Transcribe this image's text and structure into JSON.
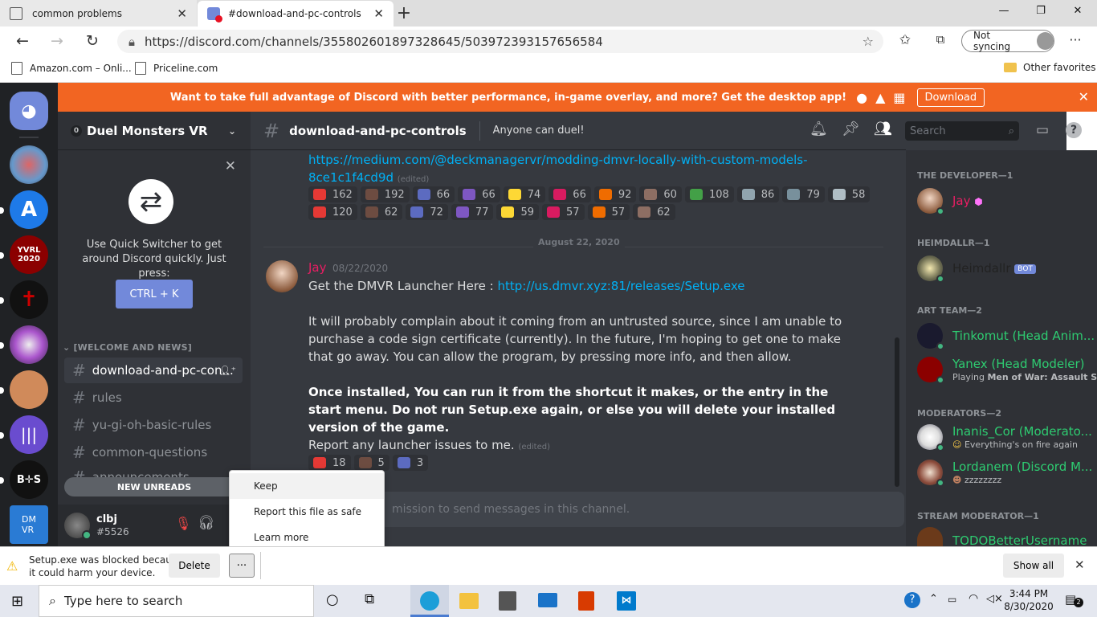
{
  "browser": {
    "tabs": [
      {
        "title": "common problems"
      },
      {
        "title": "#download-and-pc-controls"
      }
    ],
    "url": "https://discord.com/channels/355802601897328645/503972393157656584",
    "sync_label": "Not syncing",
    "bookmarks": [
      {
        "label": "Amazon.com – Onli..."
      },
      {
        "label": "Priceline.com"
      }
    ],
    "other_favorites": "Other favorites"
  },
  "banner": {
    "text": "Want to take full advantage of Discord with better performance, in-game overlay, and more? Get the desktop app!",
    "button": "Download"
  },
  "server": {
    "name": "Duel Monsters VR",
    "badge": "0"
  },
  "quick_switcher": {
    "text": "Use Quick Switcher to get around Discord quickly. Just press:",
    "shortcut": "CTRL + K"
  },
  "channels": {
    "category": "[WELCOME AND NEWS]",
    "items": [
      {
        "name": "download-and-pc-con...",
        "active": true
      },
      {
        "name": "rules"
      },
      {
        "name": "yu-gi-oh-basic-rules"
      },
      {
        "name": "common-questions"
      },
      {
        "name": "announcements"
      }
    ],
    "new_unreads": "NEW UNREADS"
  },
  "user": {
    "name": "clbj",
    "tag": "#5526"
  },
  "channel_header": {
    "name": "download-and-pc-controls",
    "topic": "Anyone can duel!",
    "search_placeholder": "Search"
  },
  "messages": {
    "prev_link": "https://medium.com/@deckmanagervr/modding-dmvr-locally-with-custom-models-8ce1c1f4cd9d",
    "prev_link_line1": "https://medium.com/@deckmanagervr/modding-dmvr-locally-with-custom-models-",
    "prev_link_line2": "8ce1c1f4cd9d",
    "edited": "(edited)",
    "reactions_row1": [
      "162",
      "192",
      "66",
      "66",
      "74",
      "66",
      "92",
      "60",
      "108",
      "86",
      "79",
      "58"
    ],
    "reactions_row2": [
      "120",
      "62",
      "72",
      "77",
      "59",
      "57",
      "57",
      "62"
    ],
    "divider_date": "August 22, 2020",
    "author": "Jay",
    "timestamp": "08/22/2020",
    "line1_prefix": "Get the DMVR Launcher Here : ",
    "line1_link": "http://us.dmvr.xyz:81/releases/Setup.exe",
    "para2": "It will probably complain about it coming from an untrusted source, since I am unable to purchase a code sign certificate (currently). In the future, I'm hoping to get one to make that go away. You can allow the program, by pressing more info, and then allow.",
    "para3_bold": "Once installed, You can run it from the shortcut it makes, or the entry in the start menu. Do not run Setup.exe again, or else you will delete your installed version of the game.",
    "para4": "Report any launcher issues to me.",
    "reactions_row3": [
      "18",
      "5",
      "3"
    ],
    "input_placeholder": "mission to send messages in this channel."
  },
  "members": {
    "groups": [
      {
        "title": "THE DEVELOPER—1",
        "members": [
          {
            "name": "Jay",
            "color": "#e91e63"
          }
        ]
      },
      {
        "title": "HEIMDALLR—1",
        "members": [
          {
            "name": "Heimdallr",
            "color": "#2f2f2f",
            "bot": "BOT"
          }
        ]
      },
      {
        "title": "ART TEAM—2",
        "members": [
          {
            "name": "Tinkomut (Head Anim...",
            "color": "#2ecc71"
          },
          {
            "name": "Yanex (Head Modeler)",
            "color": "#2ecc71",
            "activity_prefix": "Playing ",
            "activity": "Men of War: Assault S..."
          }
        ]
      },
      {
        "title": "MODERATORS—2",
        "members": [
          {
            "name": "Inanis_Cor (Moderato...",
            "color": "#2ecc71",
            "activity": "Everything's on fire again"
          },
          {
            "name": "Lordanem (Discord M...",
            "color": "#2ecc71",
            "activity": "zzzzzzzz"
          }
        ]
      },
      {
        "title": "STREAM MODERATOR—1",
        "members": [
          {
            "name": "TODOBetterUsername",
            "color": "#2ecc71"
          }
        ]
      }
    ]
  },
  "context_menu": {
    "items": [
      "Keep",
      "Report this file as safe",
      "Learn more"
    ]
  },
  "download_bar": {
    "message": "Setup.exe was blocked because it could harm your device.",
    "message_line1": "Setup.exe was blocked because",
    "message_line2": "it could harm your device.",
    "delete": "Delete",
    "more": "···",
    "show_all": "Show all"
  },
  "taskbar": {
    "search_placeholder": "Type here to search",
    "time": "3:44 PM",
    "date": "8/30/2020",
    "notifications": "2"
  }
}
